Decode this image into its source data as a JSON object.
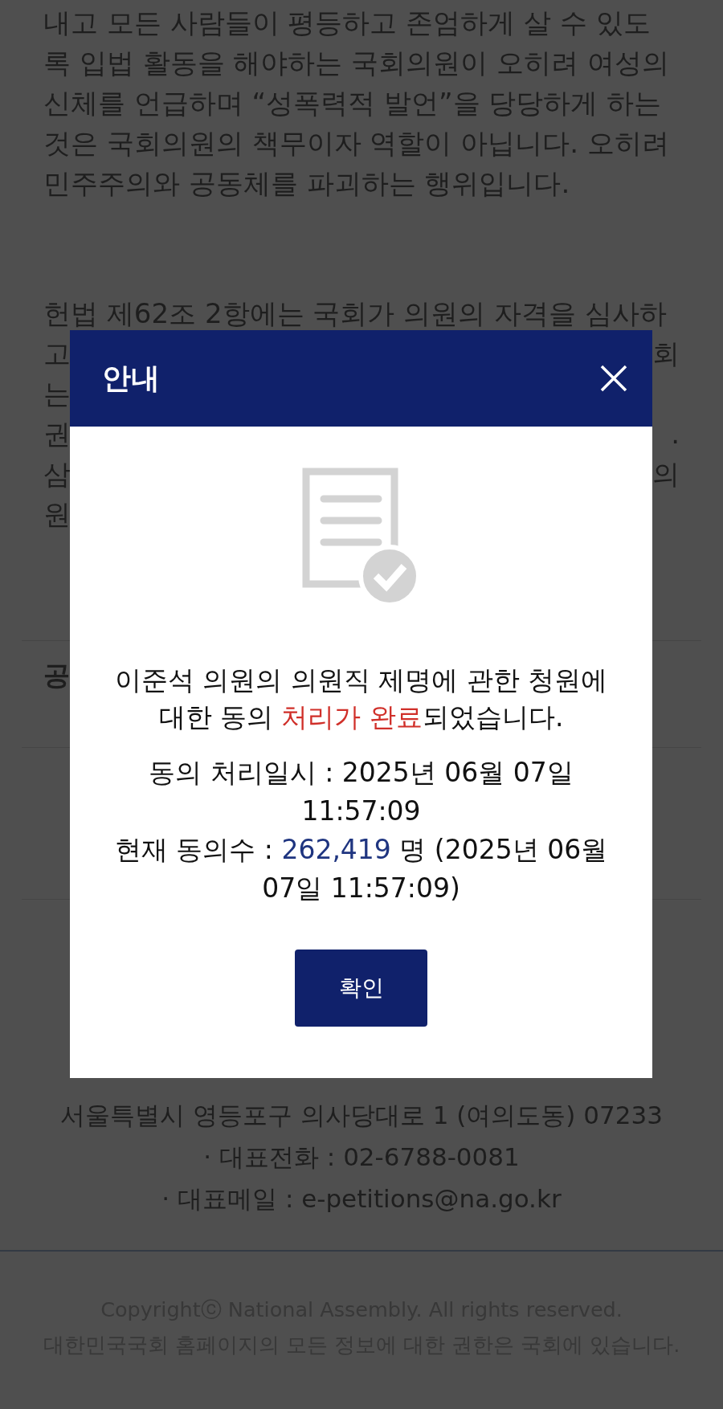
{
  "background": {
    "paragraph_lines": [
      "내고 모든 사람들이 평등하고 존엄하게 살 수 있도",
      "록 입법 활동을 해야하는 국회의원이 오히려 여성의",
      "신체를 언급하며 “성폭력적 발언”을 당당하게 하는",
      "것은 국회의원의 책무이자 역할이 아닙니다. 오히려",
      "민주주의와 공동체를 파괴하는 행위입니다."
    ],
    "covered_paragraph": {
      "first_line": "헌법 제62조 2항에는 국회가 의원의 자격을 심사하",
      "lines": [
        {
          "left": "고",
          "right": "회"
        },
        {
          "left": "는"
        },
        {
          "left": "권",
          "right": "."
        },
        {
          "left": "삼",
          "right": "의"
        },
        {
          "left": "원"
        }
      ]
    },
    "section_heading": "공"
  },
  "dialog": {
    "title": "안내",
    "message": {
      "before": "이준석 의원의 의원직 제명에 관한 청원에 대한 동의 ",
      "highlight": "처리가 완료",
      "after": "되었습니다."
    },
    "processed_at": "동의 처리일시 : 2025년 06월 07일 11:57:09",
    "count": {
      "label": "현재 동의수 : ",
      "value": "262,419",
      "suffix": " 명 (2025년 06월 07일 11:57:09)"
    },
    "confirm_button": "확인"
  },
  "footer": {
    "address": "서울특별시 영등포구 의사당대로 1 (여의도동) 07233",
    "phone": "· 대표전화 : 02-6788-0081",
    "email": "· 대표메일 : e-petitions@na.go.kr",
    "copyright": [
      "Copyrightⓒ National Assembly. All rights reserved.",
      "대한민국국회 홈페이지의 모든 정보에 대한 권한은 국회에 있습니다."
    ]
  }
}
